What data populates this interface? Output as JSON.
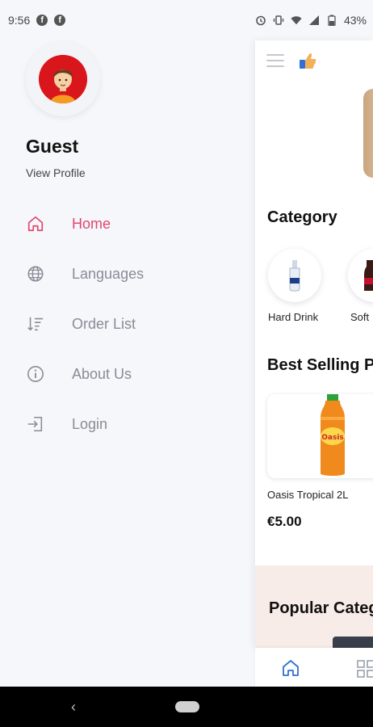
{
  "status_bar": {
    "time": "9:56",
    "battery": "43%"
  },
  "drawer": {
    "user_name": "Guest",
    "view_profile": "View Profile",
    "menu": [
      {
        "label": "Home",
        "icon": "home-icon",
        "active": true
      },
      {
        "label": "Languages",
        "icon": "globe-icon",
        "active": false
      },
      {
        "label": "Order List",
        "icon": "sort-list-icon",
        "active": false
      },
      {
        "label": "About Us",
        "icon": "info-icon",
        "active": false
      },
      {
        "label": "Login",
        "icon": "login-icon",
        "active": false
      }
    ]
  },
  "main": {
    "category_title": "Category",
    "categories": [
      {
        "label": "Hard Drink"
      },
      {
        "label": "Soft"
      }
    ],
    "best_selling_title": "Best Selling P",
    "product": {
      "name": "Oasis Tropical 2L",
      "price": "€5.00"
    },
    "popular_title": "Popular Categ"
  },
  "colors": {
    "accent": "#e2466e",
    "menu_text": "#888c96",
    "tab_active": "#2f6fd6"
  }
}
